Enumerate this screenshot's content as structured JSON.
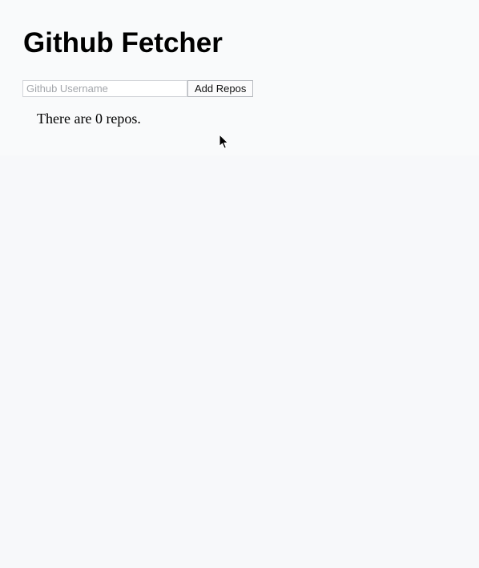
{
  "header": {
    "title": "Github Fetcher"
  },
  "search": {
    "placeholder": "Github Username",
    "value": "",
    "button_label": "Add Repos"
  },
  "repos": {
    "count_text": "There are 0 repos."
  },
  "cursor": {
    "icon": "arrow-cursor-icon"
  }
}
